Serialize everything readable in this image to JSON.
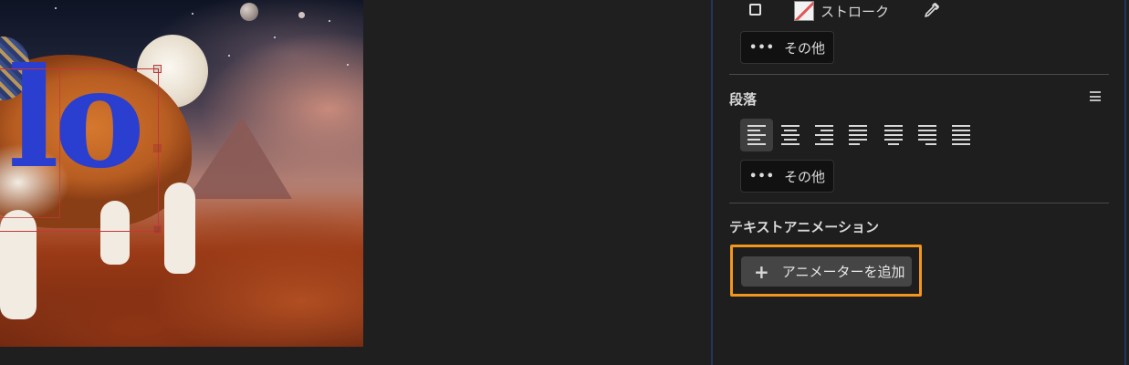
{
  "canvas": {
    "text_fragment": "lo"
  },
  "properties": {
    "character": {
      "stroke_label": "ストローク",
      "more_label": "その他",
      "more_dots": "•••"
    },
    "paragraph": {
      "title": "段落",
      "more_label": "その他",
      "more_dots": "•••",
      "alignments": [
        "align-left",
        "align-center",
        "align-right",
        "justify-left",
        "justify-center",
        "justify-right",
        "justify-all"
      ],
      "selected_alignment": "align-left"
    },
    "text_animation": {
      "title": "テキストアニメーション",
      "add_symbol": "+",
      "add_label": "アニメーターを追加"
    }
  },
  "colors": {
    "highlight": "#f2961d",
    "text_fill": "#2a3fd0",
    "selection": "#c23838"
  }
}
